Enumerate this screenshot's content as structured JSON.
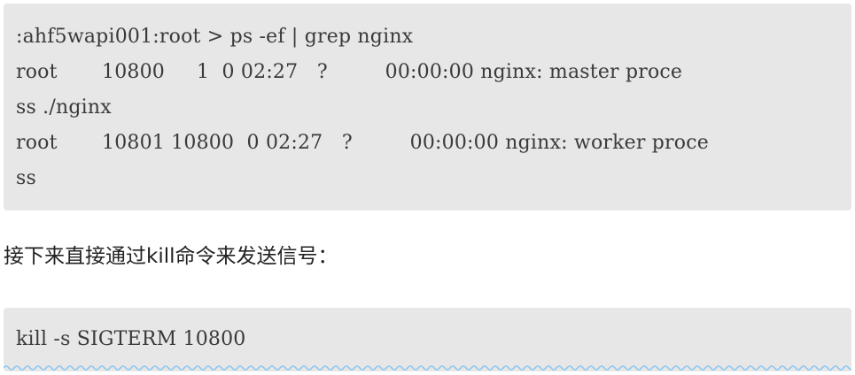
{
  "code_block_1": {
    "lines": [
      ":ahf5wapi001:root > ps -ef | grep nginx",
      "root       10800     1  0 02:27   ?         00:00:00 nginx: master proce",
      "ss ./nginx",
      "root       10801 10800  0 02:27   ?         00:00:00 nginx: worker proce",
      "ss"
    ]
  },
  "paragraph": {
    "text": "接下来直接通过kill命令来发送信号："
  },
  "code_block_2": {
    "command": "kill -s SIGTERM 10800"
  },
  "colors": {
    "code_bg": "#e7e7e7",
    "code_text": "#3a3a3a",
    "squiggle": "#8fc7ee"
  }
}
